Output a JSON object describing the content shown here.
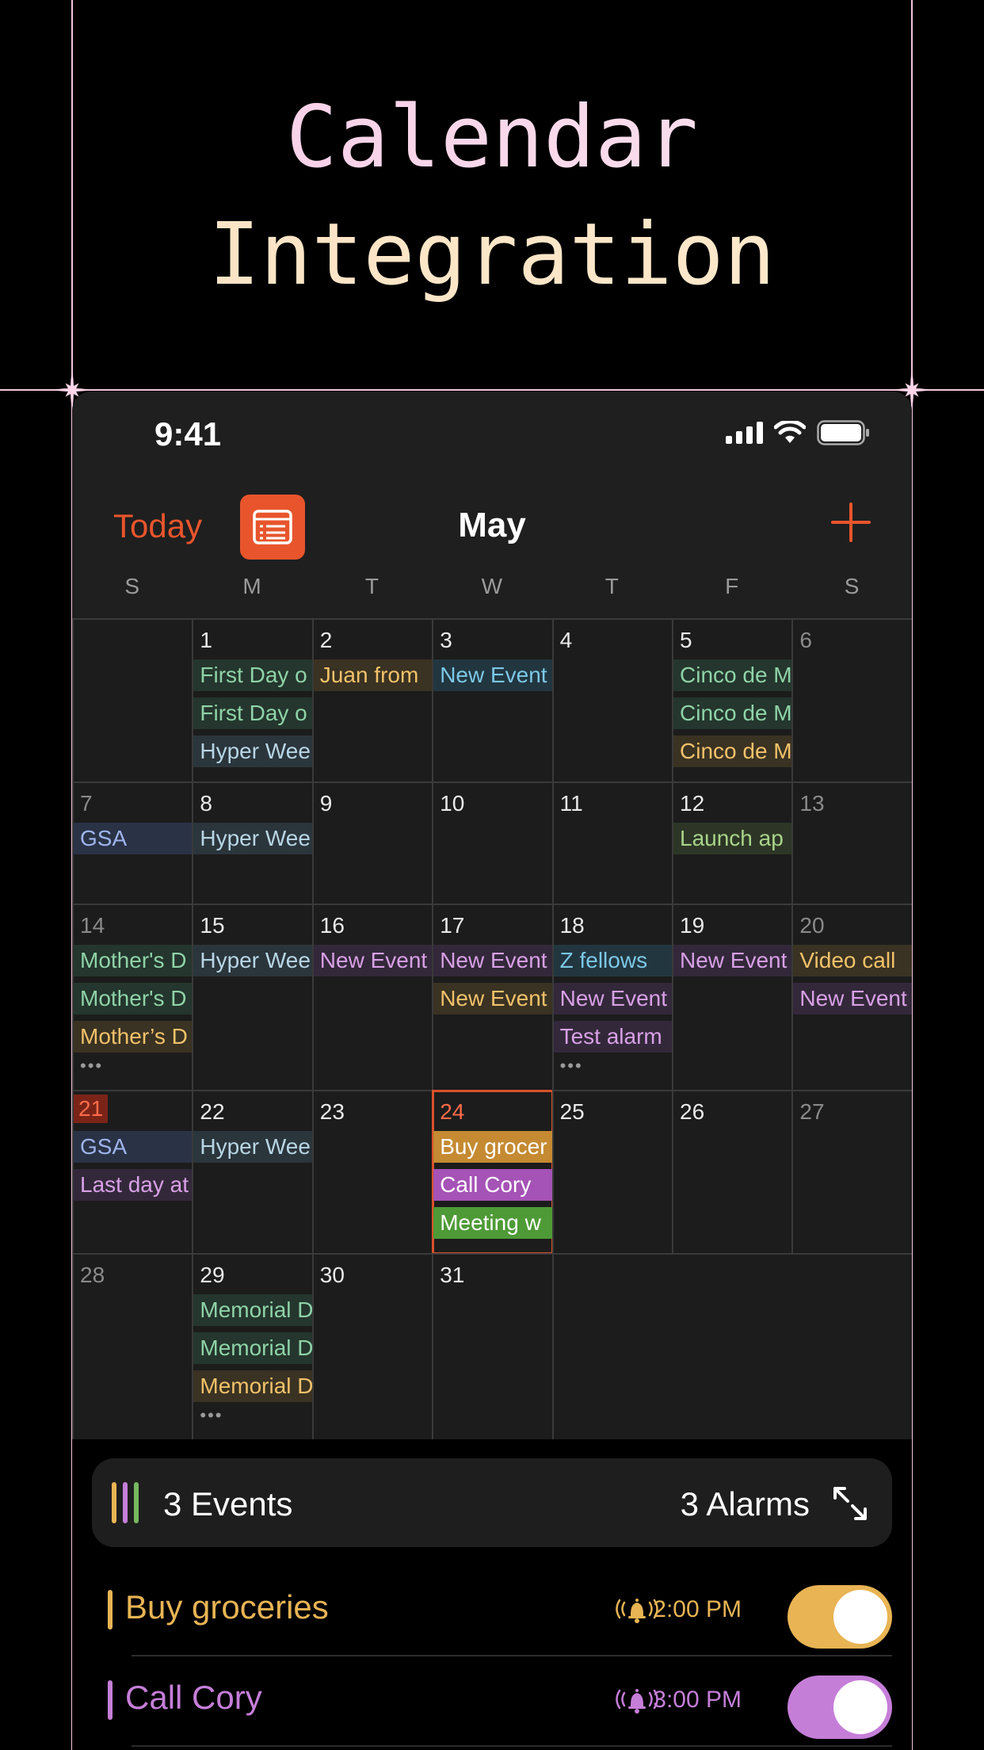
{
  "hero": {
    "line1": "Calendar",
    "line2": "Integration"
  },
  "status_bar": {
    "time": "9:41"
  },
  "toolbar": {
    "today_label": "Today",
    "month": "May",
    "accent_color": "#e8552c"
  },
  "weekdays": [
    "S",
    "M",
    "T",
    "W",
    "T",
    "F",
    "S"
  ],
  "weeks": [
    [
      {
        "day": "",
        "events": []
      },
      {
        "day": "1",
        "events": [
          {
            "title": "First Day o",
            "style": "green"
          },
          {
            "title": "First Day o",
            "style": "green"
          },
          {
            "title": "Hyper Wee",
            "style": "slate"
          }
        ]
      },
      {
        "day": "2",
        "events": [
          {
            "title": "Juan from",
            "style": "amber"
          }
        ]
      },
      {
        "day": "3",
        "events": [
          {
            "title": "New Event",
            "style": "teal"
          }
        ]
      },
      {
        "day": "4",
        "events": []
      },
      {
        "day": "5",
        "events": [
          {
            "title": "Cinco de M",
            "style": "green"
          },
          {
            "title": "Cinco de M",
            "style": "green"
          },
          {
            "title": "Cinco de M",
            "style": "amber"
          }
        ]
      },
      {
        "day": "6",
        "dim": true,
        "events": []
      }
    ],
    [
      {
        "day": "7",
        "dim": true,
        "events": [
          {
            "title": "GSA",
            "style": "blue"
          }
        ]
      },
      {
        "day": "8",
        "events": [
          {
            "title": "Hyper Wee",
            "style": "slate"
          }
        ]
      },
      {
        "day": "9",
        "events": []
      },
      {
        "day": "10",
        "events": []
      },
      {
        "day": "11",
        "events": []
      },
      {
        "day": "12",
        "events": [
          {
            "title": "Launch ap",
            "style": "olive"
          }
        ]
      },
      {
        "day": "13",
        "dim": true,
        "events": []
      }
    ],
    [
      {
        "day": "14",
        "dim": true,
        "events": [
          {
            "title": "Mother's D",
            "style": "green"
          },
          {
            "title": "Mother's D",
            "style": "green"
          },
          {
            "title": "Mother’s D",
            "style": "amber"
          }
        ],
        "more": "•••"
      },
      {
        "day": "15",
        "events": [
          {
            "title": "Hyper Wee",
            "style": "slate"
          }
        ]
      },
      {
        "day": "16",
        "events": [
          {
            "title": "New Event",
            "style": "purple"
          }
        ]
      },
      {
        "day": "17",
        "events": [
          {
            "title": "New Event",
            "style": "purple"
          },
          {
            "title": "New Event",
            "style": "amber"
          }
        ]
      },
      {
        "day": "18",
        "events": [
          {
            "title": "Z fellows",
            "style": "teal"
          },
          {
            "title": "New Event",
            "style": "purple"
          },
          {
            "title": "Test alarm",
            "style": "purple"
          }
        ],
        "more": "•••"
      },
      {
        "day": "19",
        "events": [
          {
            "title": "New Event",
            "style": "purple"
          }
        ]
      },
      {
        "day": "20",
        "dim": true,
        "events": [
          {
            "title": "Video call",
            "style": "amber"
          },
          {
            "title": "New Event",
            "style": "purple"
          }
        ]
      }
    ],
    [
      {
        "day": "21",
        "today": true,
        "events": [
          {
            "title": "GSA",
            "style": "blue"
          },
          {
            "title": "Last day at",
            "style": "purple"
          }
        ]
      },
      {
        "day": "22",
        "events": [
          {
            "title": "Hyper Wee",
            "style": "slate"
          }
        ]
      },
      {
        "day": "23",
        "events": []
      },
      {
        "day": "24",
        "selected": true,
        "events": [
          {
            "title": "Buy grocer",
            "style": "amber-solid"
          },
          {
            "title": "Call Cory",
            "style": "purple-solid"
          },
          {
            "title": "Meeting w",
            "style": "green-solid"
          }
        ]
      },
      {
        "day": "25",
        "events": []
      },
      {
        "day": "26",
        "events": []
      },
      {
        "day": "27",
        "dim": true,
        "events": []
      }
    ],
    [
      {
        "day": "28",
        "dim": true,
        "events": []
      },
      {
        "day": "29",
        "events": [
          {
            "title": "Memorial D",
            "style": "green"
          },
          {
            "title": "Memorial D",
            "style": "green"
          },
          {
            "title": "Memorial D",
            "style": "amber"
          }
        ],
        "more": "•••"
      },
      {
        "day": "30",
        "events": []
      },
      {
        "day": "31",
        "events": []
      }
    ]
  ],
  "summary": {
    "events_label": "3 Events",
    "alarms_label": "3 Alarms"
  },
  "alarms": [
    {
      "title": "Buy groceries",
      "time": "2:00 PM",
      "color": "#e8b454",
      "enabled": true
    },
    {
      "title": "Call Cory",
      "time": "3:00 PM",
      "color": "#c57ed8",
      "enabled": true
    }
  ]
}
